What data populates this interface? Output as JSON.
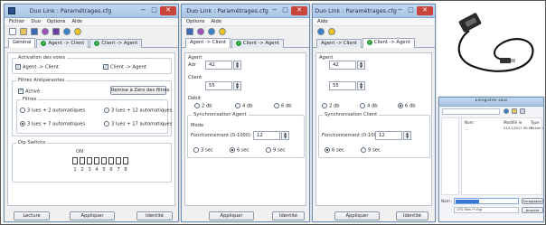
{
  "app": {
    "title": "Duo Link : Paramétrages.cfg",
    "win_min": "−",
    "win_max": "□",
    "win_close": "✕"
  },
  "menu": [
    "Fichier",
    "Duo",
    "Options",
    "Aide"
  ],
  "tabs": [
    "Général",
    "Agent -> Client",
    "Client -> Agent"
  ],
  "general": {
    "activation_title": "Activation des voies",
    "agent_client": "Agent -> Client",
    "client_agent": "Client -> Agent",
    "filtres_title": "Filtres Antiparasites",
    "active": "Activé",
    "remise_btn": "Remise à Zéro des filtres",
    "filtres_label": "Filtres",
    "opt1": "3 lues + 2 automatiques",
    "opt2": "3 lues + 12 automatiques",
    "opt3": "3 lues + 7 automatiques",
    "opt4": "3 lues + 17 automatiques",
    "dip_title": "Dip Switchs",
    "dip_on": "ON",
    "dip_nums": [
      "1",
      "2",
      "3",
      "4",
      "5",
      "6",
      "7",
      "8"
    ]
  },
  "agent_client": {
    "label_agent": "Agent",
    "label_adr": "Adr",
    "val1": "42",
    "label_client": "Client",
    "val2": "55",
    "label_debit": "Débit",
    "rates": [
      "2 db",
      "4 db",
      "6 db"
    ],
    "group_label": "Synchronisation Agent",
    "sub_label": "Mode",
    "mode_label": "Fonctionnement (0-1000)",
    "mode_val": "12",
    "modes": [
      "3 sec",
      "6 sec",
      "9 sec"
    ]
  },
  "client_agent": {
    "label_agent": "Agent",
    "val1": "42",
    "val2": "55",
    "rates": [
      "2 db",
      "4 db",
      "6 db"
    ],
    "group_label": "Synchronisation Client",
    "mode_label": "Fonctionnement (0-1000)",
    "mode_val": "12",
    "modes": [
      "6 sec",
      "9 sec"
    ]
  },
  "buttons": {
    "lecture": "Lecture",
    "appliquer": "Appliquer",
    "identite": "Identité"
  },
  "dialog": {
    "title": "Enregistrer sous",
    "col_name": "Nom",
    "col_mod": "Modifié le",
    "col_type": "Type",
    "file_name": "...",
    "file_mod": "23/11/2017 09:55",
    "file_type": "Fichier CFG",
    "name_label": "Nom :",
    "type_value": "CFG files (*.cfg)",
    "save_btn": "Enregistrer",
    "cancel_btn": "Annuler"
  }
}
